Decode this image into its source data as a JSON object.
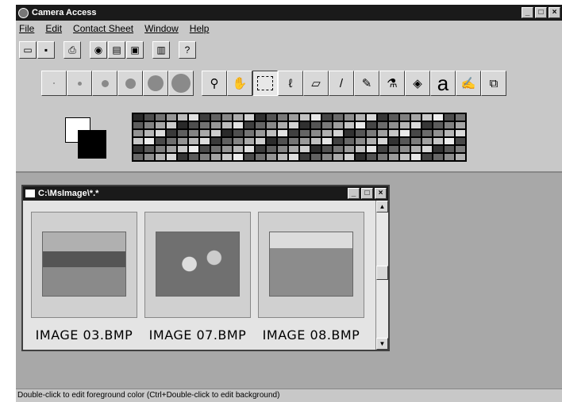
{
  "window": {
    "title": "Camera Access",
    "controls": [
      "_",
      "□",
      "×"
    ]
  },
  "menu": [
    "File",
    "Edit",
    "Contact Sheet",
    "Window",
    "Help"
  ],
  "toolbar_icons": [
    "open-icon",
    "save-icon",
    "print-icon",
    "camera-icon",
    "scan-icon",
    "acquire-icon",
    "contact-sheet-icon",
    "help-icon"
  ],
  "tools": [
    "brush-size-1",
    "brush-size-2",
    "brush-size-3",
    "brush-size-4",
    "brush-size-5",
    "brush-size-6",
    "zoom",
    "hand",
    "rect-select",
    "lasso",
    "eraser",
    "brush",
    "pencil",
    "eyedropper",
    "fill",
    "text",
    "stamp",
    "copy"
  ],
  "text_tool_glyph": "a",
  "colors": {
    "foreground": "#000000",
    "background": "#ffffff"
  },
  "child_window": {
    "title": "C:\\MsImage\\*.*",
    "controls": [
      "_",
      "□",
      "×"
    ],
    "thumbnails": [
      {
        "label": "IMAGE 03.BMP"
      },
      {
        "label": "IMAGE 07.BMP"
      },
      {
        "label": "IMAGE 08.BMP"
      }
    ]
  },
  "status": "Double-click to edit foreground color (Ctrl+Double-click to edit background)"
}
